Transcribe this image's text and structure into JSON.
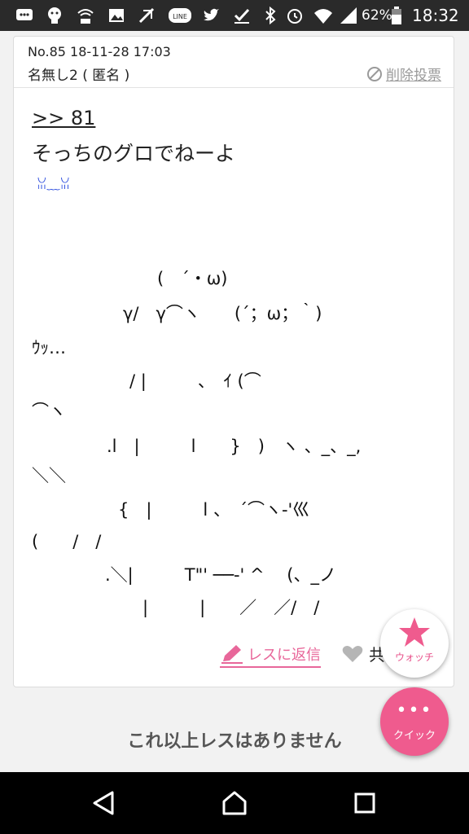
{
  "status_bar": {
    "icons": [
      "chat-icon",
      "mascot-icon",
      "wifi-calling-icon",
      "image-icon",
      "signal-app-icon",
      "line-icon",
      "twitter-icon",
      "check-icon",
      "bluetooth-icon",
      "alarm-icon",
      "wifi-icon",
      "cell-signal-icon",
      "battery-icon"
    ],
    "line_label": "LINE",
    "battery": "62%",
    "time": "18:32"
  },
  "post": {
    "meta": "No.85 18-11-28 17:03",
    "author": "名無し2 ( 匿名 )",
    "delete_vote": "削除投票",
    "reply_anchor": ">> 81",
    "text": "そっちのグロでねーよ",
    "emoticon": "ꈍ﹏ꈍ",
    "ascii_art": [
      "(　´・ω)",
      "γ/　γ⌒ヽ　　(´；ω；｀)",
      "ｳｯ…",
      "/ |　　　、　ｲ (⌒",
      "⌒ヽ",
      ".l　|　　　l　　}　)　ヽ 、_、_,",
      "＼＼",
      "{　|　　　l 、　´⌒ヽ-'巛",
      "(　　/　/",
      ".＼|　　　T\"' ──-' ^　 (、_ノ",
      "|　　　|　　／　／/　/"
    ]
  },
  "actions": {
    "reply": "レスに返信",
    "like": "共感"
  },
  "floating": {
    "watch": "ウォッチ",
    "quick_dots": "•••",
    "quick": "クイック"
  },
  "footer": {
    "no_more": "これ以上レスはありません"
  },
  "colors": {
    "accent_pink": "#e8679a",
    "quick_button": "#ef5b8e",
    "emoticon_blue": "#2244dd"
  }
}
